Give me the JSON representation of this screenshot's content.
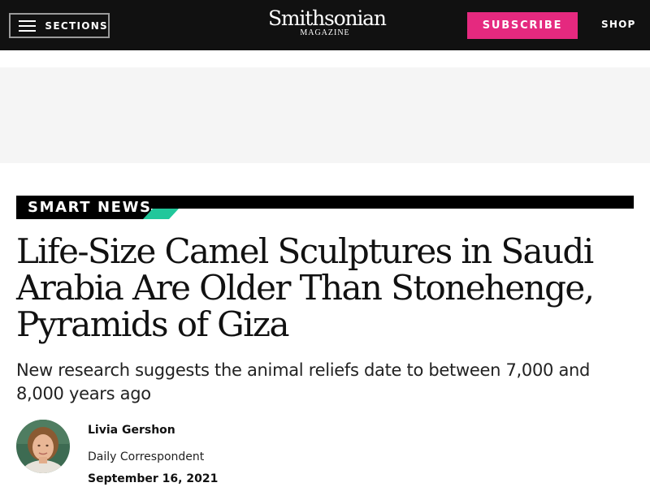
{
  "header": {
    "sections_label": "SECTIONS",
    "logo_main": "Smithsonian",
    "logo_sub": "MAGAZINE",
    "subscribe_label": "SUBSCRIBE",
    "shop_label": "SHOP"
  },
  "article": {
    "category": "SMART NEWS",
    "headline": "Life-Size Camel Sculptures in Saudi Arabia Are Older Than Stonehenge, Pyramids of Giza",
    "dek": "New research suggests the animal reliefs date to between 7,000 and 8,000 years ago",
    "author": {
      "name": "Livia Gershon",
      "role": "Daily Correspondent",
      "avatar_icon": "author-portrait"
    },
    "date": "September 16, 2021"
  },
  "colors": {
    "header_bg": "#111111",
    "subscribe_accent": "#e5297f",
    "category_accent": "#21c79b",
    "ad_bg": "#f5f5f5"
  },
  "icons": {
    "menu": "hamburger-menu-icon"
  }
}
